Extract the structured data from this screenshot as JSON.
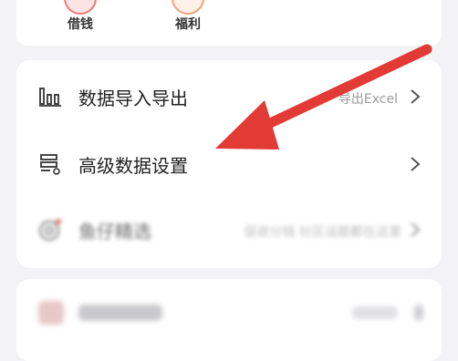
{
  "top_nav": {
    "items": [
      {
        "label": "借钱",
        "icon": "loan-icon"
      },
      {
        "label": "福利",
        "icon": "gift-icon"
      }
    ]
  },
  "settings": {
    "rows": [
      {
        "title": "数据导入导出",
        "subtitle": "导出Excel",
        "icon": "bar-chart-icon"
      },
      {
        "title": "高级数据设置",
        "subtitle": "",
        "icon": "data-settings-icon"
      },
      {
        "title": "鱼仔精选",
        "subtitle": "促收分钱  社区话题都在这里",
        "icon": "target-icon"
      }
    ]
  },
  "annotation": {
    "color": "#e23a35"
  }
}
